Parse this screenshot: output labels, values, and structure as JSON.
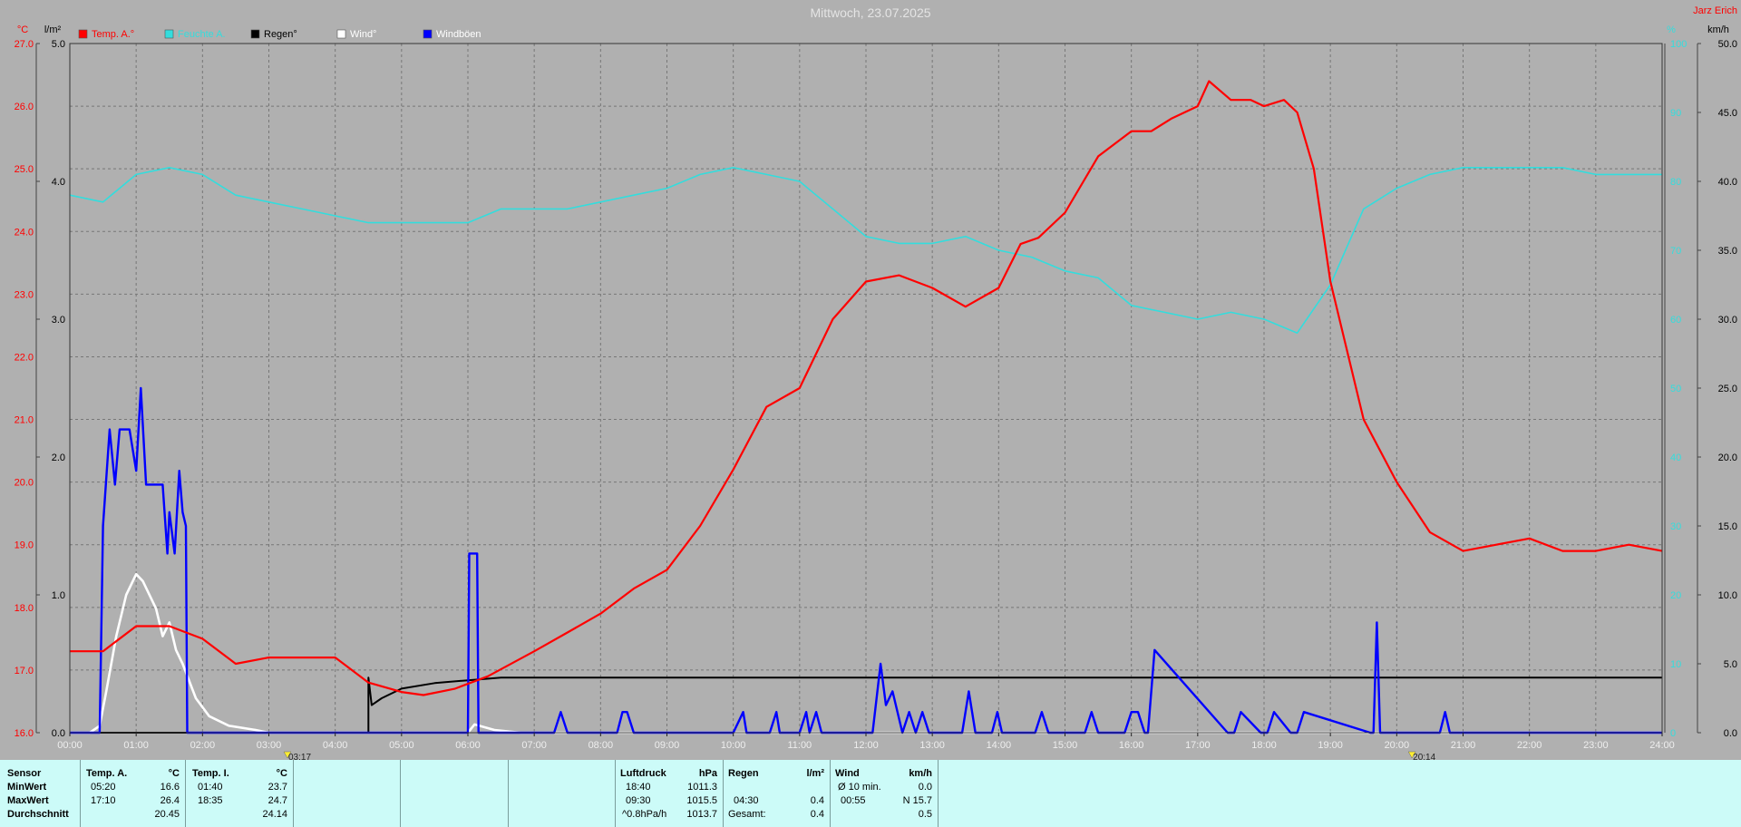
{
  "header": {
    "title": "Mittwoch, 23.07.2025",
    "corner_label": "Jarz Erich"
  },
  "units": {
    "left_temp": "°C",
    "left_rain": "l/m²",
    "right_percent": "%",
    "right_wind": "km/h"
  },
  "legend": [
    {
      "label": "Temp. A.°",
      "color": "#ff0000",
      "text_color": "#ff0000"
    },
    {
      "label": "Feuchte A.",
      "color": "#33dddd",
      "text_color": "#33dddd"
    },
    {
      "label": "Regen°",
      "color": "#000000",
      "text_color": "#000000"
    },
    {
      "label": "Wind°",
      "color": "#ffffff",
      "text_color": "#ffffff"
    },
    {
      "label": "Windböen",
      "color": "#0000ff",
      "text_color": "#ffffff"
    }
  ],
  "sun_markers": [
    {
      "label": "03:17",
      "hour": 3.28
    },
    {
      "label": "20:14",
      "hour": 20.23
    }
  ],
  "chart_data": {
    "type": "line",
    "title": "Mittwoch, 23.07.2025",
    "x_unit": "hour",
    "xlim": [
      0,
      24
    ],
    "x_ticks": [
      "00:00",
      "01:00",
      "02:00",
      "03:00",
      "04:00",
      "05:00",
      "06:00",
      "07:00",
      "08:00",
      "09:00",
      "10:00",
      "11:00",
      "12:00",
      "13:00",
      "14:00",
      "15:00",
      "16:00",
      "17:00",
      "18:00",
      "19:00",
      "20:00",
      "21:00",
      "22:00",
      "23:00",
      "24:00"
    ],
    "axes": {
      "temp": {
        "unit": "°C",
        "lim": [
          16.0,
          27.0
        ],
        "ticks": [
          "16.0",
          "17.0",
          "18.0",
          "19.0",
          "20.0",
          "21.0",
          "22.0",
          "23.0",
          "24.0",
          "25.0",
          "26.0",
          "27.0"
        ]
      },
      "rain": {
        "unit": "l/m²",
        "lim": [
          0.0,
          5.0
        ],
        "ticks": [
          "0.0",
          "1.0",
          "2.0",
          "3.0",
          "4.0",
          "5.0"
        ]
      },
      "percent": {
        "unit": "%",
        "lim": [
          0,
          100
        ],
        "ticks": [
          "0",
          "10",
          "20",
          "30",
          "40",
          "50",
          "60",
          "70",
          "80",
          "90",
          "100"
        ]
      },
      "wind": {
        "unit": "km/h",
        "lim": [
          0.0,
          50.0
        ],
        "ticks": [
          "0.0",
          "5.0",
          "10.0",
          "15.0",
          "20.0",
          "25.0",
          "30.0",
          "35.0",
          "40.0",
          "45.0",
          "50.0"
        ]
      }
    },
    "grid": true,
    "series": [
      {
        "name": "Temp. A.°",
        "axis": "temp",
        "color": "#ff0000",
        "x": [
          0,
          0.5,
          1.0,
          1.5,
          2.0,
          2.5,
          3.0,
          3.5,
          4.0,
          4.5,
          5.0,
          5.33,
          5.8,
          6.3,
          7.0,
          7.5,
          8.0,
          8.5,
          9.0,
          9.5,
          10.0,
          10.5,
          11.0,
          11.5,
          12.0,
          12.5,
          13.0,
          13.5,
          14.0,
          14.33,
          14.6,
          15.0,
          15.5,
          16.0,
          16.3,
          16.6,
          17.0,
          17.17,
          17.5,
          17.8,
          18.0,
          18.3,
          18.5,
          18.75,
          19.0,
          19.5,
          20.0,
          20.5,
          21.0,
          21.5,
          22.0,
          22.5,
          23.0,
          23.5,
          24.0
        ],
        "y": [
          17.3,
          17.3,
          17.7,
          17.7,
          17.5,
          17.1,
          17.2,
          17.2,
          17.2,
          16.8,
          16.65,
          16.6,
          16.7,
          16.9,
          17.3,
          17.6,
          17.9,
          18.3,
          18.6,
          19.3,
          20.2,
          21.2,
          21.5,
          22.6,
          23.2,
          23.3,
          23.1,
          22.8,
          23.1,
          23.8,
          23.9,
          24.3,
          25.2,
          25.6,
          25.6,
          25.8,
          26.0,
          26.4,
          26.1,
          26.1,
          26.0,
          26.1,
          25.9,
          25.0,
          23.2,
          21.0,
          20.0,
          19.2,
          18.9,
          19.0,
          19.1,
          18.9,
          18.9,
          19.0,
          18.9
        ]
      },
      {
        "name": "Feuchte A.",
        "axis": "percent",
        "color": "#33dddd",
        "x": [
          0,
          0.5,
          1.0,
          1.5,
          2.0,
          2.5,
          3.0,
          3.5,
          4.0,
          4.5,
          5.0,
          5.5,
          6.0,
          6.5,
          7.0,
          7.5,
          8.0,
          8.5,
          9.0,
          9.5,
          10.0,
          10.5,
          11.0,
          11.5,
          12.0,
          12.5,
          13.0,
          13.5,
          14.0,
          14.5,
          15.0,
          15.5,
          16.0,
          16.5,
          17.0,
          17.5,
          18.0,
          18.5,
          19.0,
          19.5,
          20.0,
          20.5,
          21.0,
          21.5,
          22.0,
          22.5,
          23.0,
          23.5,
          24.0
        ],
        "y": [
          78,
          77,
          81,
          82,
          81,
          78,
          77,
          76,
          75,
          74,
          74,
          74,
          74,
          76,
          76,
          76,
          77,
          78,
          79,
          81,
          82,
          81,
          80,
          76,
          72,
          71,
          71,
          72,
          70,
          69,
          67,
          66,
          62,
          61,
          60,
          61,
          60,
          58,
          65,
          76,
          79,
          81,
          82,
          82,
          82,
          82,
          81,
          81,
          81
        ]
      },
      {
        "name": "Regen°",
        "axis": "rain",
        "color": "#000000",
        "x": [
          0,
          3.5,
          4.0,
          4.4,
          4.5,
          4.5,
          4.55,
          4.7,
          5.0,
          5.5,
          6.0,
          6.5,
          7.0,
          24.0
        ],
        "y": [
          0,
          0,
          0,
          0,
          0,
          0.4,
          0.2,
          0.25,
          0.32,
          0.36,
          0.38,
          0.4,
          0.4,
          0.4
        ]
      },
      {
        "name": "Wind°",
        "axis": "wind",
        "color": "#ffffff",
        "x": [
          0,
          0.3,
          0.45,
          0.55,
          0.7,
          0.85,
          1.0,
          1.1,
          1.3,
          1.4,
          1.5,
          1.6,
          1.7,
          1.9,
          2.1,
          2.4,
          2.8,
          3.0,
          4.0,
          6.0,
          6.1,
          6.4,
          6.8,
          7.0,
          24.0
        ],
        "y": [
          0,
          0,
          0.5,
          3,
          7,
          10,
          11.5,
          11,
          9,
          7,
          8,
          6,
          5,
          2.5,
          1.2,
          0.5,
          0.2,
          0,
          0,
          0,
          0.6,
          0.2,
          0,
          0,
          0
        ]
      },
      {
        "name": "Windböen",
        "axis": "wind",
        "color": "#0000ff",
        "x": [
          0,
          0.45,
          0.5,
          0.6,
          0.68,
          0.75,
          0.9,
          1.0,
          1.07,
          1.15,
          1.25,
          1.4,
          1.47,
          1.5,
          1.58,
          1.65,
          1.7,
          1.75,
          1.77,
          1.8,
          1.9,
          6.0,
          6.02,
          6.1,
          6.14,
          6.16,
          6.2,
          7.3,
          7.4,
          7.5,
          8.25,
          8.33,
          8.4,
          8.5,
          10.0,
          10.15,
          10.2,
          10.55,
          10.65,
          10.7,
          11.0,
          11.1,
          11.15,
          11.25,
          11.33,
          11.4,
          12.1,
          12.22,
          12.3,
          12.4,
          12.55,
          12.65,
          12.75,
          12.85,
          12.95,
          13.45,
          13.55,
          13.65,
          13.9,
          13.98,
          14.05,
          14.55,
          14.65,
          14.75,
          15.3,
          15.4,
          15.5,
          15.9,
          16.0,
          16.1,
          16.2,
          16.25,
          16.35,
          17.45,
          17.55,
          17.65,
          17.95,
          18.05,
          18.15,
          18.4,
          18.5,
          18.6,
          19.6,
          19.65,
          19.7,
          19.75,
          20.65,
          20.73,
          20.8,
          24.0
        ],
        "y": [
          0,
          0,
          15,
          22,
          18,
          22,
          22,
          19,
          25,
          18,
          18,
          18,
          13,
          16,
          13,
          19,
          16,
          15,
          0,
          0,
          0,
          0,
          13,
          13,
          13,
          0,
          0,
          0,
          1.5,
          0,
          0,
          1.5,
          1.5,
          0,
          0,
          1.5,
          0,
          0,
          1.5,
          0,
          0,
          1.5,
          0,
          1.5,
          0,
          0,
          0,
          5,
          2,
          3,
          0,
          1.5,
          0,
          1.5,
          0,
          0,
          3,
          0,
          0,
          1.5,
          0,
          0,
          1.5,
          0,
          0,
          1.5,
          0,
          0,
          1.5,
          1.5,
          0,
          0,
          6,
          0,
          0,
          1.5,
          0,
          0,
          1.5,
          0,
          0,
          1.5,
          0,
          0,
          8,
          0,
          0,
          1.5,
          0,
          0
        ]
      }
    ]
  },
  "stats": {
    "row_labels": [
      "Sensor",
      "MinWert",
      "MaxWert",
      "Durchschnitt"
    ],
    "temp_a": {
      "head": "Temp. A.",
      "unit": "°C",
      "min_time": "05:20",
      "min_val": "16.6",
      "max_time": "17:10",
      "max_val": "26.4",
      "avg": "20.45"
    },
    "temp_i": {
      "head": "Temp. I.",
      "unit": "°C",
      "min_time": "01:40",
      "min_val": "23.7",
      "max_time": "18:35",
      "max_val": "24.7",
      "avg": "24.14"
    },
    "pressure": {
      "head": "Luftdruck",
      "unit": "hPa",
      "r1_time": "18:40",
      "r1_val": "1011.3",
      "r2_time": "09:30",
      "r2_val": "1015.5",
      "r3_label": "^0.8hPa/h",
      "r3_val": "1013.7"
    },
    "rain": {
      "head": "Regen",
      "unit": "l/m²",
      "r2_time": "04:30",
      "r2_val": "0.4",
      "r3_label": "Gesamt:",
      "r3_val": "0.4"
    },
    "wind": {
      "head": "Wind",
      "unit": "km/h",
      "r1_label": "Ø 10 min.",
      "r1_val": "0.0",
      "r2_time": "00:55",
      "r2_val": "N 15.7",
      "r3_val": "0.5"
    }
  }
}
